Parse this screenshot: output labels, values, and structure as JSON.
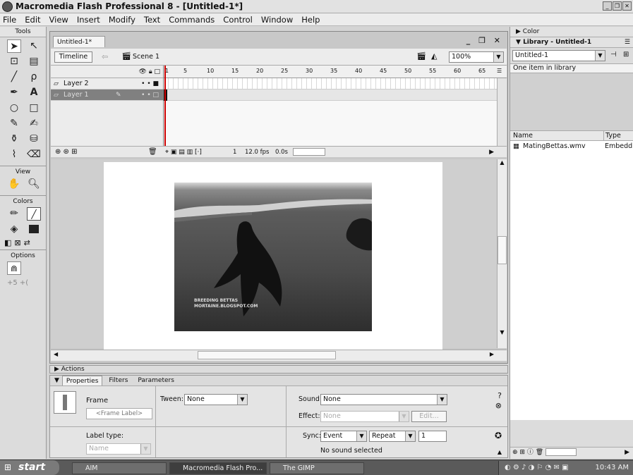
{
  "window": {
    "title": "Macromedia Flash Professional 8 - [Untitled-1*]"
  },
  "menu": [
    "File",
    "Edit",
    "View",
    "Insert",
    "Modify",
    "Text",
    "Commands",
    "Control",
    "Window",
    "Help"
  ],
  "tools": {
    "header": "Tools",
    "view_label": "View",
    "colors_label": "Colors",
    "options_label": "Options"
  },
  "document": {
    "tab": "Untitled-1*",
    "timeline_button": "Timeline",
    "scene": "Scene 1",
    "zoom": "100%",
    "layers": [
      "Layer 2",
      "Layer 1"
    ],
    "ruler_ticks": [
      "1",
      "5",
      "10",
      "15",
      "20",
      "25",
      "30",
      "35",
      "40",
      "45",
      "50",
      "55",
      "60",
      "65"
    ],
    "current_frame": "1",
    "fps": "12.0 fps",
    "elapsed": "0.0s"
  },
  "video": {
    "watermark_line1": "Breeding Bettas",
    "watermark_line2": "mortaine.blogspot.com"
  },
  "panels": {
    "actions": "Actions",
    "tabs": [
      "Properties",
      "Filters",
      "Parameters"
    ],
    "frame_label": "Frame",
    "frame_label_placeholder": "<Frame Label>",
    "tween_label": "Tween:",
    "tween_value": "None",
    "sound_label": "Sound:",
    "sound_value": "None",
    "effect_label": "Effect:",
    "effect_value": "None",
    "edit_button": "Edit...",
    "label_type_label": "Label type:",
    "label_type_value": "Name",
    "sync_label": "Sync:",
    "sync_value": "Event",
    "repeat_value": "Repeat",
    "repeat_count": "1",
    "no_sound": "No sound selected"
  },
  "right": {
    "color_panel": "Color",
    "library_panel": "Library - Untitled-1",
    "library_doc": "Untitled-1",
    "library_count": "One item in library",
    "col_name": "Name",
    "col_type": "Type",
    "item_name": "MatingBettas.wmv",
    "item_type": "Embedd"
  },
  "taskbar": {
    "start": "start",
    "items": [
      "AIM",
      "Macromedia Flash Pro...",
      "The GIMP"
    ],
    "clock": "10:43 AM"
  }
}
